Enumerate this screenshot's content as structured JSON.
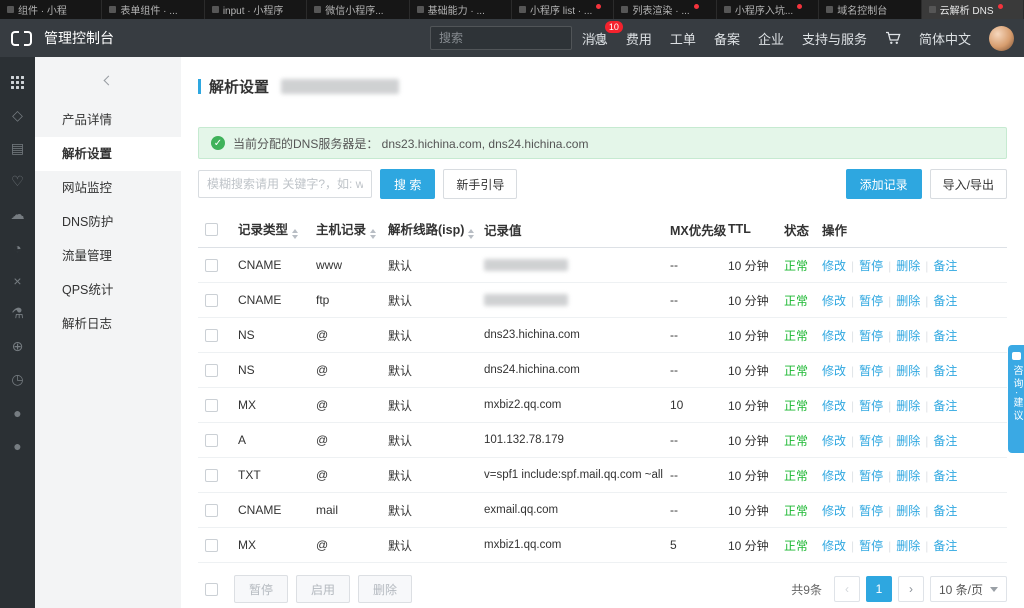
{
  "colors": {
    "accent": "#2ea7e0",
    "status_ok": "#1db833",
    "badge": "#f5222d",
    "banner_bg": "#e4f6e9",
    "header_bg": "#373c41"
  },
  "browser_tabs": [
    {
      "label": "组件 · 小程",
      "dot": false,
      "active": false
    },
    {
      "label": "表单组件 · ...",
      "dot": false,
      "active": false
    },
    {
      "label": "input · 小程序",
      "dot": false,
      "active": false
    },
    {
      "label": "微信小程序...",
      "dot": false,
      "active": false
    },
    {
      "label": "基础能力 · ...",
      "dot": false,
      "active": false
    },
    {
      "label": "小程序 list · ...",
      "dot": true,
      "active": false
    },
    {
      "label": "列表渲染 · ...",
      "dot": true,
      "active": false
    },
    {
      "label": "小程序入坑...",
      "dot": true,
      "active": false
    },
    {
      "label": "域名控制台",
      "dot": false,
      "active": false
    },
    {
      "label": "云解析 DNS",
      "dot": true,
      "active": true
    }
  ],
  "header": {
    "title": "管理控制台",
    "search_placeholder": "搜索",
    "menu": [
      {
        "id": "messages",
        "label": "消息",
        "badge": "10"
      },
      {
        "id": "billing",
        "label": "费用",
        "badge": ""
      },
      {
        "id": "tickets",
        "label": "工单",
        "badge": ""
      },
      {
        "id": "icp",
        "label": "备案",
        "badge": ""
      },
      {
        "id": "enterprise",
        "label": "企业",
        "badge": ""
      },
      {
        "id": "support",
        "label": "支持与服务",
        "badge": ""
      }
    ],
    "lang": "简体中文"
  },
  "icon_sidebar": [
    {
      "name": "apps-grid",
      "glyph": "",
      "bright": true
    },
    {
      "name": "diamond",
      "glyph": "◇",
      "bright": false
    },
    {
      "name": "list",
      "glyph": "▤",
      "bright": false
    },
    {
      "name": "heart",
      "glyph": "♡",
      "bright": false
    },
    {
      "name": "cloud",
      "glyph": "☁",
      "bright": false
    },
    {
      "name": "gauge",
      "glyph": "◔",
      "bright": false
    },
    {
      "name": "close",
      "glyph": "×",
      "bright": false
    },
    {
      "name": "flask",
      "glyph": "⚗",
      "bright": false
    },
    {
      "name": "globe",
      "glyph": "⊕",
      "bright": false
    },
    {
      "name": "clock",
      "glyph": "◷",
      "bright": false
    },
    {
      "name": "product-a",
      "glyph": "●",
      "bright": false
    },
    {
      "name": "product-b",
      "glyph": "●",
      "bright": false
    }
  ],
  "nav": {
    "items": [
      {
        "id": "product-detail",
        "label": "产品详情",
        "active": false
      },
      {
        "id": "dns-settings",
        "label": "解析设置",
        "active": true
      },
      {
        "id": "site-monitor",
        "label": "网站监控",
        "active": false
      },
      {
        "id": "dns-protect",
        "label": "DNS防护",
        "active": false
      },
      {
        "id": "traffic",
        "label": "流量管理",
        "active": false
      },
      {
        "id": "qps",
        "label": "QPS统计",
        "active": false
      },
      {
        "id": "logs",
        "label": "解析日志",
        "active": false
      }
    ]
  },
  "page": {
    "title": "解析设置",
    "dns_banner": "当前分配的DNS服务器是： dns23.hichina.com, dns24.hichina.com",
    "search_placeholder": "模糊搜索请用 关键字?，如: w?",
    "search_button": "搜 索",
    "guide_button": "新手引导",
    "add_button": "添加记录",
    "import_button": "导入/导出"
  },
  "table": {
    "columns": [
      {
        "label": "记录类型",
        "sortable": true
      },
      {
        "label": "主机记录",
        "sortable": true
      },
      {
        "label": "解析线路(isp)",
        "sortable": true
      },
      {
        "label": "记录值",
        "sortable": false
      },
      {
        "label": "MX优先级",
        "sortable": false
      },
      {
        "label": "TTL",
        "sortable": false
      },
      {
        "label": "状态",
        "sortable": false
      },
      {
        "label": "操作",
        "sortable": false
      }
    ],
    "actions": [
      "修改",
      "暂停",
      "删除",
      "备注"
    ],
    "rows": [
      {
        "type": "CNAME",
        "host": "www",
        "line": "默认",
        "value": "",
        "redacted": true,
        "mx": "--",
        "ttl": "10 分钟",
        "status": "正常"
      },
      {
        "type": "CNAME",
        "host": "ftp",
        "line": "默认",
        "value": "",
        "redacted": true,
        "mx": "--",
        "ttl": "10 分钟",
        "status": "正常"
      },
      {
        "type": "NS",
        "host": "@",
        "line": "默认",
        "value": "dns23.hichina.com",
        "redacted": false,
        "mx": "--",
        "ttl": "10 分钟",
        "status": "正常"
      },
      {
        "type": "NS",
        "host": "@",
        "line": "默认",
        "value": "dns24.hichina.com",
        "redacted": false,
        "mx": "--",
        "ttl": "10 分钟",
        "status": "正常"
      },
      {
        "type": "MX",
        "host": "@",
        "line": "默认",
        "value": "mxbiz2.qq.com",
        "redacted": false,
        "mx": "10",
        "ttl": "10 分钟",
        "status": "正常"
      },
      {
        "type": "A",
        "host": "@",
        "line": "默认",
        "value": "101.132.78.179",
        "redacted": false,
        "mx": "--",
        "ttl": "10 分钟",
        "status": "正常"
      },
      {
        "type": "TXT",
        "host": "@",
        "line": "默认",
        "value": "v=spf1 include:spf.mail.qq.com ~all",
        "redacted": false,
        "mx": "--",
        "ttl": "10 分钟",
        "status": "正常"
      },
      {
        "type": "CNAME",
        "host": "mail",
        "line": "默认",
        "value": "exmail.qq.com",
        "redacted": false,
        "mx": "--",
        "ttl": "10 分钟",
        "status": "正常"
      },
      {
        "type": "MX",
        "host": "@",
        "line": "默认",
        "value": "mxbiz1.qq.com",
        "redacted": false,
        "mx": "5",
        "ttl": "10 分钟",
        "status": "正常"
      }
    ]
  },
  "footer": {
    "batch_buttons": [
      {
        "id": "pause",
        "label": "暂停"
      },
      {
        "id": "enable",
        "label": "启用"
      },
      {
        "id": "delete",
        "label": "删除"
      }
    ],
    "total": "共9条",
    "page": "1",
    "page_size": "10 条/页"
  },
  "float_widget": {
    "label": "咨询·建议"
  }
}
